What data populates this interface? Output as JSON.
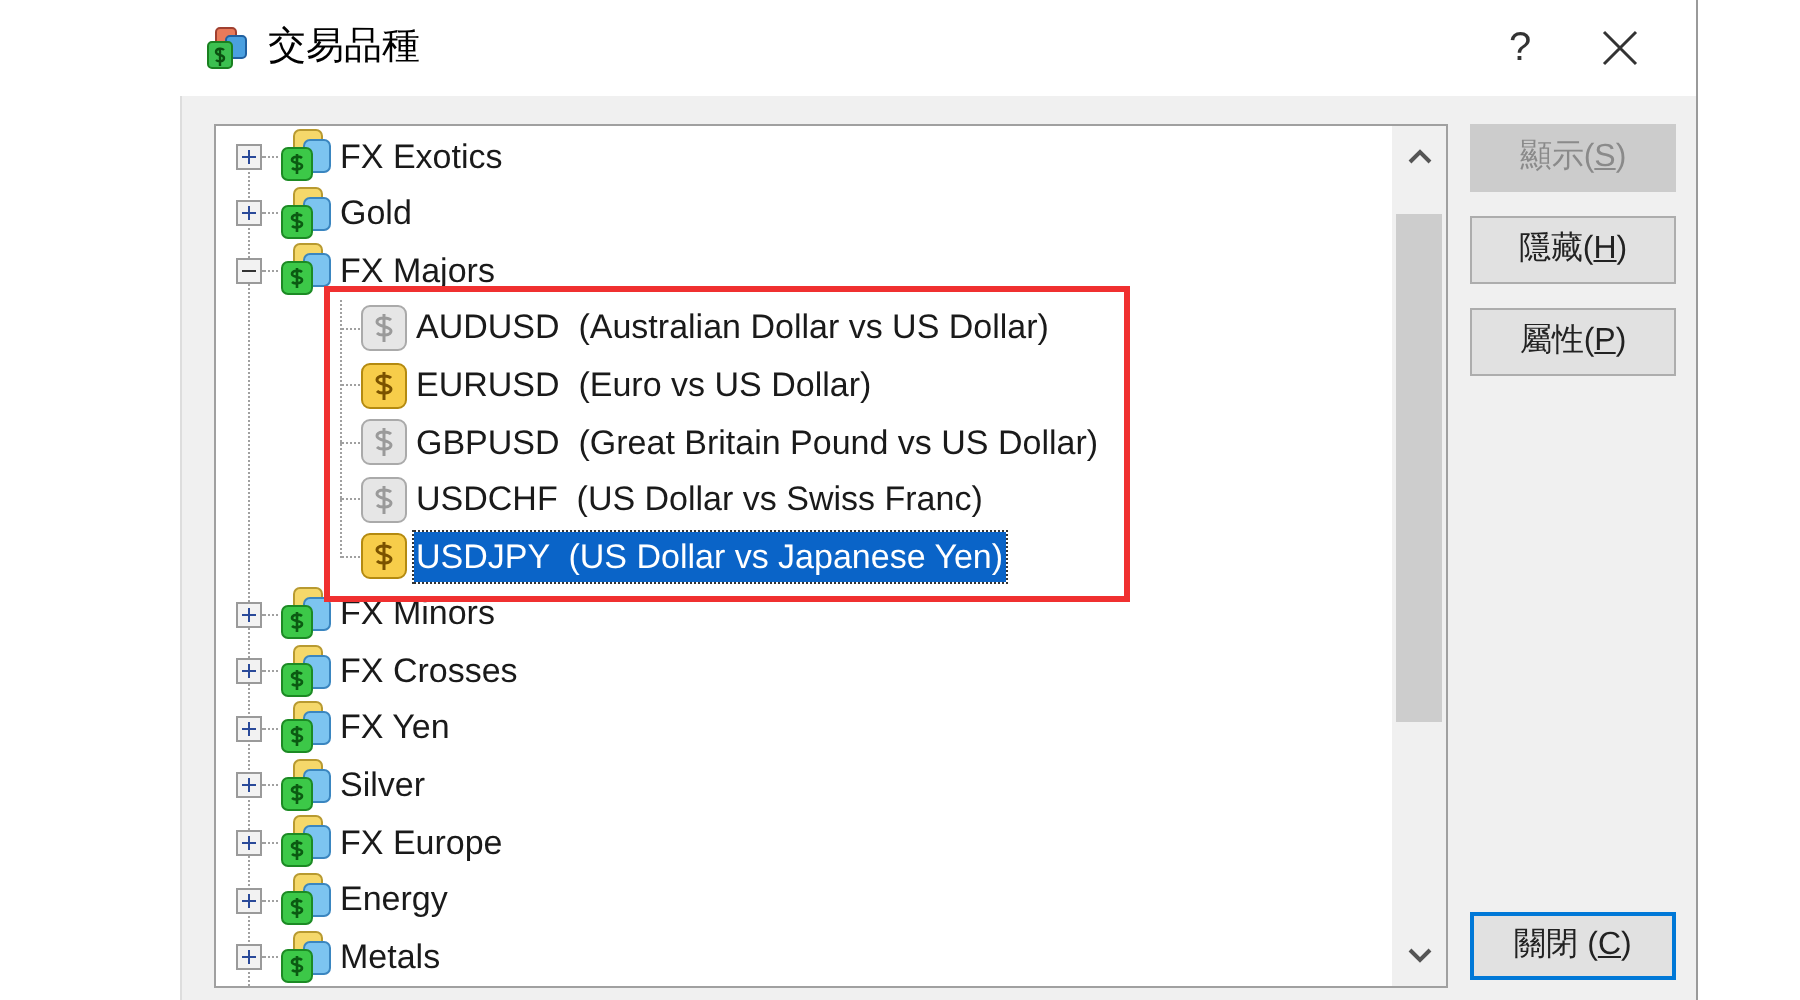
{
  "window": {
    "title": "交易品種",
    "help": "?"
  },
  "tree": [
    {
      "label": "FX Exotics",
      "expanded": false
    },
    {
      "label": "Gold",
      "expanded": false
    },
    {
      "label": "FX Majors",
      "expanded": true,
      "children": [
        {
          "label": "AUDUSD  (Australian Dollar vs US Dollar)",
          "visible": false,
          "selected": false
        },
        {
          "label": "EURUSD  (Euro vs US Dollar)",
          "visible": true,
          "selected": false
        },
        {
          "label": "GBPUSD  (Great Britain Pound vs US Dollar)",
          "visible": false,
          "selected": false
        },
        {
          "label": "USDCHF  (US Dollar vs Swiss Franc)",
          "visible": false,
          "selected": false
        },
        {
          "label": "USDJPY  (US Dollar vs Japanese Yen)",
          "visible": true,
          "selected": true
        }
      ]
    },
    {
      "label": "FX Minors",
      "expanded": false
    },
    {
      "label": "FX Crosses",
      "expanded": false
    },
    {
      "label": "FX Yen",
      "expanded": false
    },
    {
      "label": "Silver",
      "expanded": false
    },
    {
      "label": "FX Europe",
      "expanded": false
    },
    {
      "label": "Energy",
      "expanded": false
    },
    {
      "label": "Metals",
      "expanded": false
    }
  ],
  "buttons": [
    {
      "before": "顯示(",
      "key": "S",
      "after": ")",
      "disabled": true
    },
    {
      "before": "隱藏(",
      "key": "H",
      "after": ")",
      "disabled": false
    },
    {
      "before": "屬性(",
      "key": "P",
      "after": ")",
      "disabled": false
    }
  ],
  "close_button": {
    "before": "關閉 (",
    "key": "C",
    "after": ")",
    "disabled": false
  }
}
